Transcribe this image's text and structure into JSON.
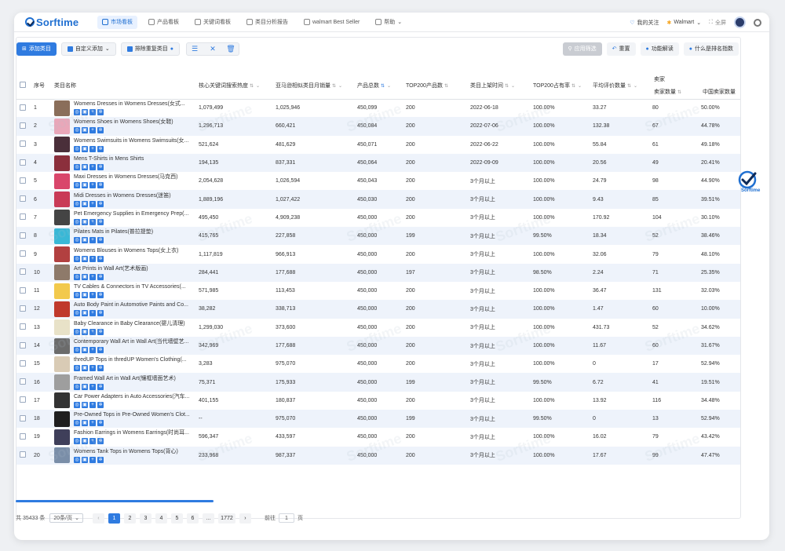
{
  "topbar": {
    "logo": "Sorftime",
    "nav": [
      "市场看板",
      "产品看板",
      "关键词看板",
      "类目分析报告",
      "walmart Best Seller",
      "帮助"
    ],
    "my_follow": "我的关注",
    "marketplace": "Walmart",
    "fullscreen": "全屏"
  },
  "toolbar": {
    "add_category": "添加类目",
    "custom_add": "自定义添加",
    "exclude_dup": "排除重复类目",
    "apply_filter": "应用筛选",
    "reset": "重置",
    "feature_desc": "功能解读",
    "rank_index": "什么是排名指数"
  },
  "table": {
    "headers": [
      "序号",
      "类目名称",
      "核心关键词搜索热度",
      "亚马逊相似类目月销量",
      "产品总数",
      "TOP200产品数",
      "类目上架时间",
      "TOP200占有率",
      "平均评价数量",
      "卖家数量",
      "中国卖家数量"
    ],
    "seller_group": "卖家",
    "rows": [
      {
        "no": "1",
        "name": "Womens Dresses in Womens Dresses(女式...",
        "heat": "1,079,499",
        "sales": "1,025,946",
        "total": "450,099",
        "top200": "200",
        "time": "2022-06-18",
        "share": "100.00%",
        "reviews": "33.27",
        "sellers": "80",
        "cn": "50.00%"
      },
      {
        "no": "2",
        "name": "Womens Shoes in Womens Shoes(女鞋)",
        "heat": "1,296,713",
        "sales": "660,421",
        "total": "450,084",
        "top200": "200",
        "time": "2022-07-06",
        "share": "100.00%",
        "reviews": "132.38",
        "sellers": "67",
        "cn": "44.78%"
      },
      {
        "no": "3",
        "name": "Womens Swimsuits in Womens Swimsuits(女...",
        "heat": "521,624",
        "sales": "481,629",
        "total": "450,071",
        "top200": "200",
        "time": "2022-06-22",
        "share": "100.00%",
        "reviews": "55.84",
        "sellers": "61",
        "cn": "49.18%"
      },
      {
        "no": "4",
        "name": "Mens T-Shirts in Mens Shirts",
        "heat": "194,135",
        "sales": "837,331",
        "total": "450,064",
        "top200": "200",
        "time": "2022-09-09",
        "share": "100.00%",
        "reviews": "20.56",
        "sellers": "49",
        "cn": "20.41%"
      },
      {
        "no": "5",
        "name": "Maxi Dresses in Womens Dresses(马克西)",
        "heat": "2,054,628",
        "sales": "1,026,594",
        "total": "450,043",
        "top200": "200",
        "time": "3个月以上",
        "share": "100.00%",
        "reviews": "24.79",
        "sellers": "98",
        "cn": "44.90%"
      },
      {
        "no": "6",
        "name": "Midi Dresses in Womens Dresses(迷笛)",
        "heat": "1,889,196",
        "sales": "1,027,422",
        "total": "450,030",
        "top200": "200",
        "time": "3个月以上",
        "share": "100.00%",
        "reviews": "9.43",
        "sellers": "85",
        "cn": "39.51%"
      },
      {
        "no": "7",
        "name": "Pet Emergency Supplies in Emergency Prep(...",
        "heat": "495,450",
        "sales": "4,909,238",
        "total": "450,000",
        "top200": "200",
        "time": "3个月以上",
        "share": "100.00%",
        "reviews": "170.92",
        "sellers": "104",
        "cn": "30.10%"
      },
      {
        "no": "8",
        "name": "Pilates Mats in Pilates(普拉提垫)",
        "heat": "415,765",
        "sales": "227,858",
        "total": "450,000",
        "top200": "199",
        "time": "3个月以上",
        "share": "99.50%",
        "reviews": "18.34",
        "sellers": "52",
        "cn": "38.46%"
      },
      {
        "no": "9",
        "name": "Womens Blouses in Womens Tops(女上衣)",
        "heat": "1,117,819",
        "sales": "966,913",
        "total": "450,000",
        "top200": "200",
        "time": "3个月以上",
        "share": "100.00%",
        "reviews": "32.06",
        "sellers": "79",
        "cn": "48.10%"
      },
      {
        "no": "10",
        "name": "Art Prints in Wall Art(艺术版画)",
        "heat": "284,441",
        "sales": "177,688",
        "total": "450,000",
        "top200": "197",
        "time": "3个月以上",
        "share": "98.50%",
        "reviews": "2.24",
        "sellers": "71",
        "cn": "25.35%"
      },
      {
        "no": "11",
        "name": "TV Cables & Connectors in TV Accessories(...",
        "heat": "571,985",
        "sales": "113,453",
        "total": "450,000",
        "top200": "200",
        "time": "3个月以上",
        "share": "100.00%",
        "reviews": "36.47",
        "sellers": "131",
        "cn": "32.03%"
      },
      {
        "no": "12",
        "name": "Auto Body Paint in Automotive Paints and Co...",
        "heat": "38,282",
        "sales": "338,713",
        "total": "450,000",
        "top200": "200",
        "time": "3个月以上",
        "share": "100.00%",
        "reviews": "1.47",
        "sellers": "60",
        "cn": "10.00%"
      },
      {
        "no": "13",
        "name": "Baby Clearance in Baby Clearance(婴儿清理)",
        "heat": "1,299,030",
        "sales": "373,600",
        "total": "450,000",
        "top200": "200",
        "time": "3个月以上",
        "share": "100.00%",
        "reviews": "431.73",
        "sellers": "52",
        "cn": "34.62%"
      },
      {
        "no": "14",
        "name": "Contemporary Wall Art in Wall Art(当代墙壁艺...",
        "heat": "342,969",
        "sales": "177,688",
        "total": "450,000",
        "top200": "200",
        "time": "3个月以上",
        "share": "100.00%",
        "reviews": "11.67",
        "sellers": "60",
        "cn": "31.67%"
      },
      {
        "no": "15",
        "name": "thredUP Tops in thredUP Women's Clothing(...",
        "heat": "3,283",
        "sales": "975,070",
        "total": "450,000",
        "top200": "200",
        "time": "3个月以上",
        "share": "100.00%",
        "reviews": "0",
        "sellers": "17",
        "cn": "52.94%"
      },
      {
        "no": "16",
        "name": "Framed Wall Art in Wall Art(镶框墙面艺术)",
        "heat": "75,371",
        "sales": "175,933",
        "total": "450,000",
        "top200": "199",
        "time": "3个月以上",
        "share": "99.50%",
        "reviews": "6.72",
        "sellers": "41",
        "cn": "19.51%"
      },
      {
        "no": "17",
        "name": "Car Power Adapters in Auto Accessories(汽车...",
        "heat": "401,155",
        "sales": "180,837",
        "total": "450,000",
        "top200": "200",
        "time": "3个月以上",
        "share": "100.00%",
        "reviews": "13.92",
        "sellers": "116",
        "cn": "34.48%"
      },
      {
        "no": "18",
        "name": "Pre-Owned Tops in Pre-Owned Women's Clot...",
        "heat": "--",
        "sales": "975,070",
        "total": "450,000",
        "top200": "199",
        "time": "3个月以上",
        "share": "99.50%",
        "reviews": "0",
        "sellers": "13",
        "cn": "52.94%"
      },
      {
        "no": "19",
        "name": "Fashion Earrings in Womens Earrings(时尚耳...",
        "heat": "596,347",
        "sales": "433,597",
        "total": "450,000",
        "top200": "200",
        "time": "3个月以上",
        "share": "100.00%",
        "reviews": "16.02",
        "sellers": "79",
        "cn": "43.42%"
      },
      {
        "no": "20",
        "name": "Womens Tank Tops in Womens Tops(背心)",
        "heat": "233,968",
        "sales": "987,337",
        "total": "450,000",
        "top200": "200",
        "time": "3个月以上",
        "share": "100.00%",
        "reviews": "17.67",
        "sellers": "99",
        "cn": "47.47%"
      }
    ]
  },
  "pagination": {
    "total": "共 35433 条",
    "page_size": "20条/页",
    "pages": [
      "1",
      "2",
      "3",
      "4",
      "5",
      "6",
      "...",
      "1772"
    ],
    "goto_label": "前往",
    "goto_value": "1",
    "goto_suffix": "页"
  },
  "side_badge": "Sorftime",
  "watermark": "Sorftime",
  "colors": {
    "primary": "#2f7be0",
    "stripe": "#eef3fb"
  },
  "thumb_colors": [
    "#8a6e5a",
    "#e9a7b9",
    "#4a2f3a",
    "#8b2f3c",
    "#d9466b",
    "#c93b57",
    "#444444",
    "#39b8d6",
    "#b24040",
    "#8e7a6a",
    "#f2c94c",
    "#c0392b",
    "#e8e2c8",
    "#6b6b6b",
    "#d9cbb5",
    "#9e9e9e",
    "#333333",
    "#1f1f1f",
    "#3f3f5a",
    "#7a8ea8"
  ]
}
